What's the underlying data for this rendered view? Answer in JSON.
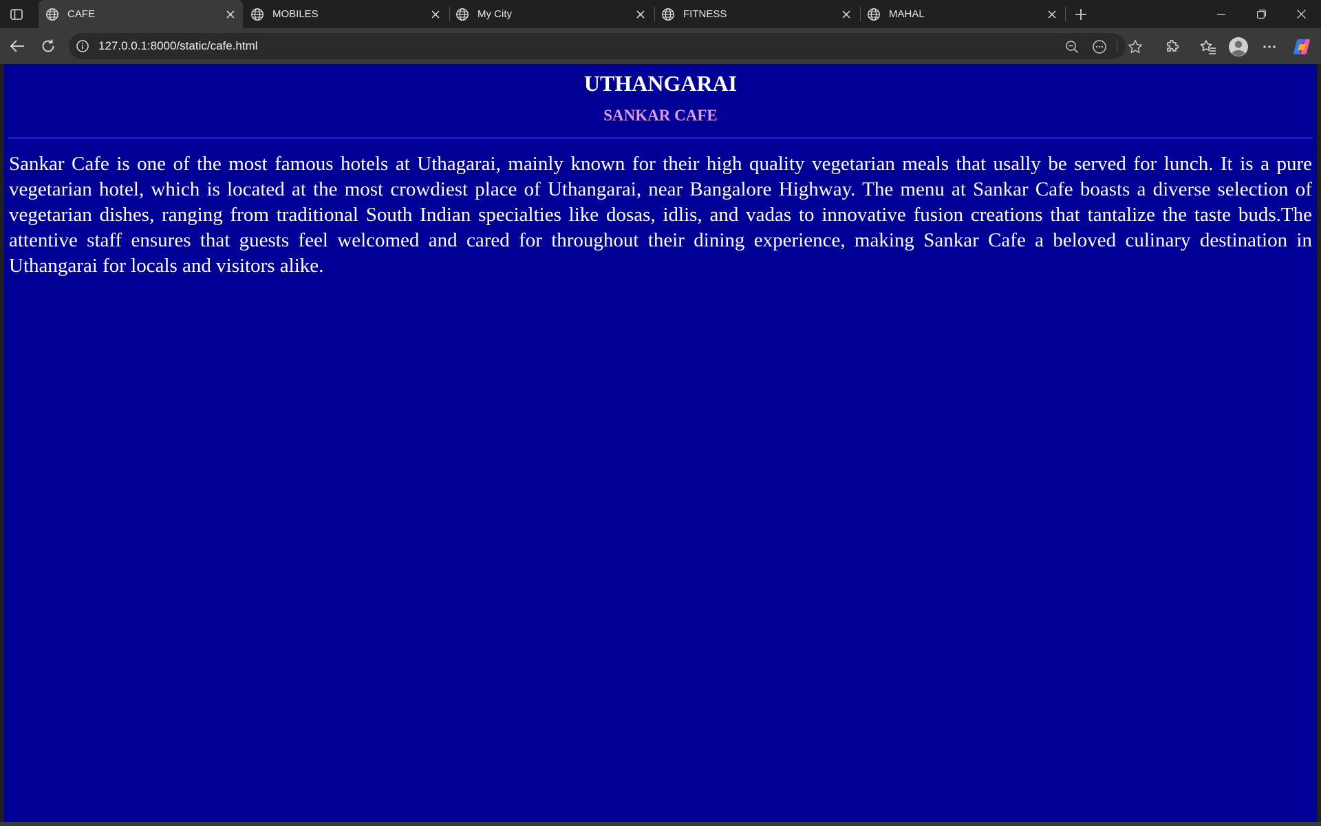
{
  "browser": {
    "tabs": [
      {
        "title": "CAFE",
        "active": true
      },
      {
        "title": "MOBILES",
        "active": false
      },
      {
        "title": "My City",
        "active": false
      },
      {
        "title": "FITNESS",
        "active": false
      },
      {
        "title": "MAHAL",
        "active": false
      }
    ],
    "address_bar": {
      "url": "127.0.0.1:8000/static/cafe.html"
    },
    "icons": {
      "sidebar": "sidebar-toggle-icon",
      "tab": "globe-icon",
      "close": "close-icon",
      "new_tab": "plus-icon",
      "back": "back-arrow-icon",
      "refresh": "refresh-icon",
      "site_info": "info-icon",
      "zoom": "zoom-out-icon",
      "reader": "more-circle-icon",
      "favorite": "star-icon",
      "extensions": "puzzle-icon",
      "favorites": "favorites-icon",
      "profile": "avatar-icon",
      "menu": "ellipsis-icon",
      "copilot": "copilot-icon"
    }
  },
  "page": {
    "title": "UTHANGARAI",
    "subtitle": "SANKAR CAFE",
    "body": "Sankar Cafe is one of the most famous hotels at Uthagarai, mainly known for their high quality vegetarian meals that usally be served for lunch. It is a pure vegetarian hotel, which is located at the most crowdiest place of Uthangarai, near Bangalore Highway. The menu at Sankar Cafe boasts a diverse selection of vegetarian dishes, ranging from traditional South Indian specialties like dosas, idlis, and vadas to innovative fusion creations that tantalize the taste buds.The attentive staff ensures that guests feel welcomed and cared for throughout their dining experience, making Sankar Cafe a beloved culinary destination in Uthangarai for locals and visitors alike.",
    "colors": {
      "background": "#000096",
      "title": "#ffffff",
      "subtitle": "#d99be6",
      "rule": "#1818e0",
      "body_text": "#ffffff"
    }
  }
}
